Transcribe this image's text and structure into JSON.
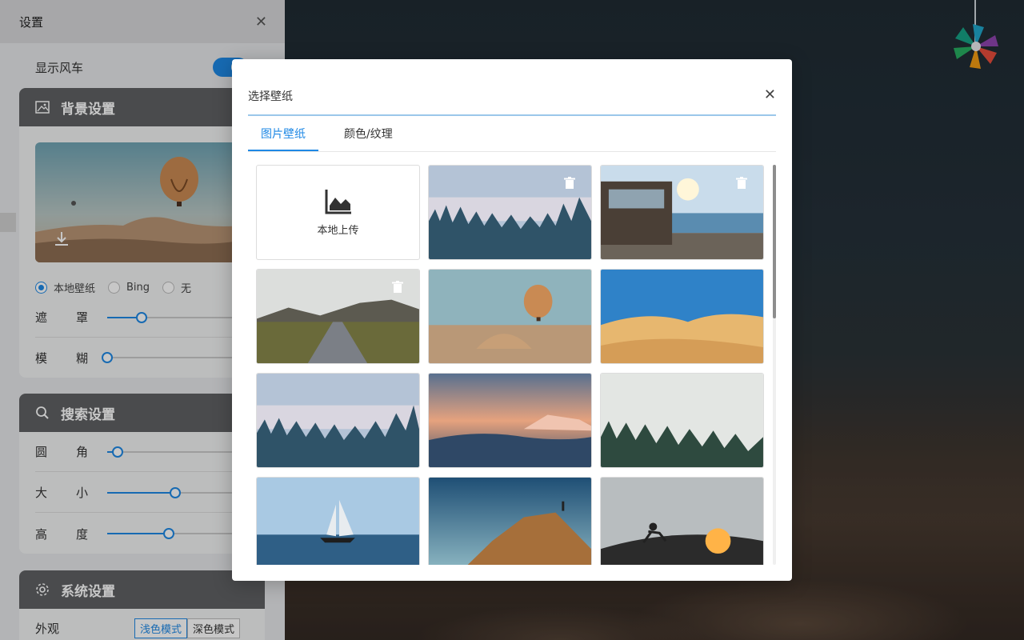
{
  "settings": {
    "title": "设置",
    "show_windmill_label": "显示风车",
    "background": {
      "header": "背景设置",
      "radios": [
        "本地壁纸",
        "Bing",
        "无"
      ],
      "selected": "本地壁纸",
      "mask_label_a": "遮",
      "mask_label_b": "罩",
      "mask_value": 0.24,
      "blur_label_a": "模",
      "blur_label_b": "糊",
      "blur_value": 0.0
    },
    "search": {
      "header": "搜索设置",
      "radius_a": "圆",
      "radius_b": "角",
      "radius_value": 0.07,
      "size_a": "大",
      "size_b": "小",
      "size_value": 0.47,
      "height_a": "高",
      "height_b": "度",
      "height_value": 0.43
    },
    "system": {
      "header": "系统设置",
      "appearance_label": "外观",
      "light": "浅色模式",
      "dark": "深色模式"
    }
  },
  "modal": {
    "title": "选择壁纸",
    "tabs": [
      "图片壁纸",
      "颜色/纹理"
    ],
    "upload_label": "本地上传",
    "colors": {
      "accent": "#1e88e5"
    }
  }
}
